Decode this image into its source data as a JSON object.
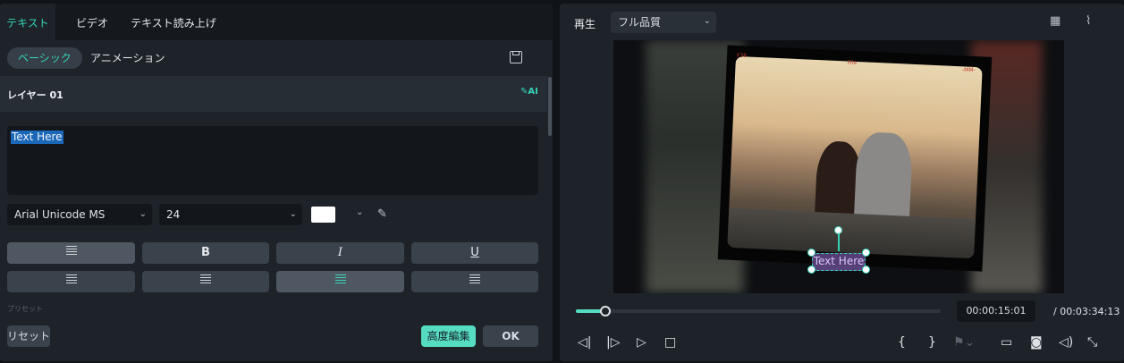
{
  "left_panel": {
    "tabs": [
      "テキスト",
      "ビデオ",
      "テキスト読み上げ"
    ],
    "subtabs": [
      "ベーシック",
      "アニメーション"
    ],
    "layer_label": "レイヤー 01",
    "ai_icon_text": "AI",
    "text_value": "Text Here",
    "font": "Arial Unicode MS",
    "font_size": "24",
    "text_color": "#ffffff",
    "style_buttons": [
      "B",
      "I",
      "U"
    ],
    "faded_text": "プリセット",
    "reset_label": "リセット",
    "advanced_label": "高度編集",
    "ok_label": "OK",
    "accent": "#35d3b6"
  },
  "right_panel": {
    "playback_label": "再生",
    "quality": "フル品質",
    "overlay_text": "Text Here",
    "current_time": "00:00:15:01",
    "separator": "/",
    "total_time": "00:03:34:13",
    "progress_fraction": 0.02,
    "film_marks": [
      "F36",
      "File",
      "-MM-"
    ]
  }
}
